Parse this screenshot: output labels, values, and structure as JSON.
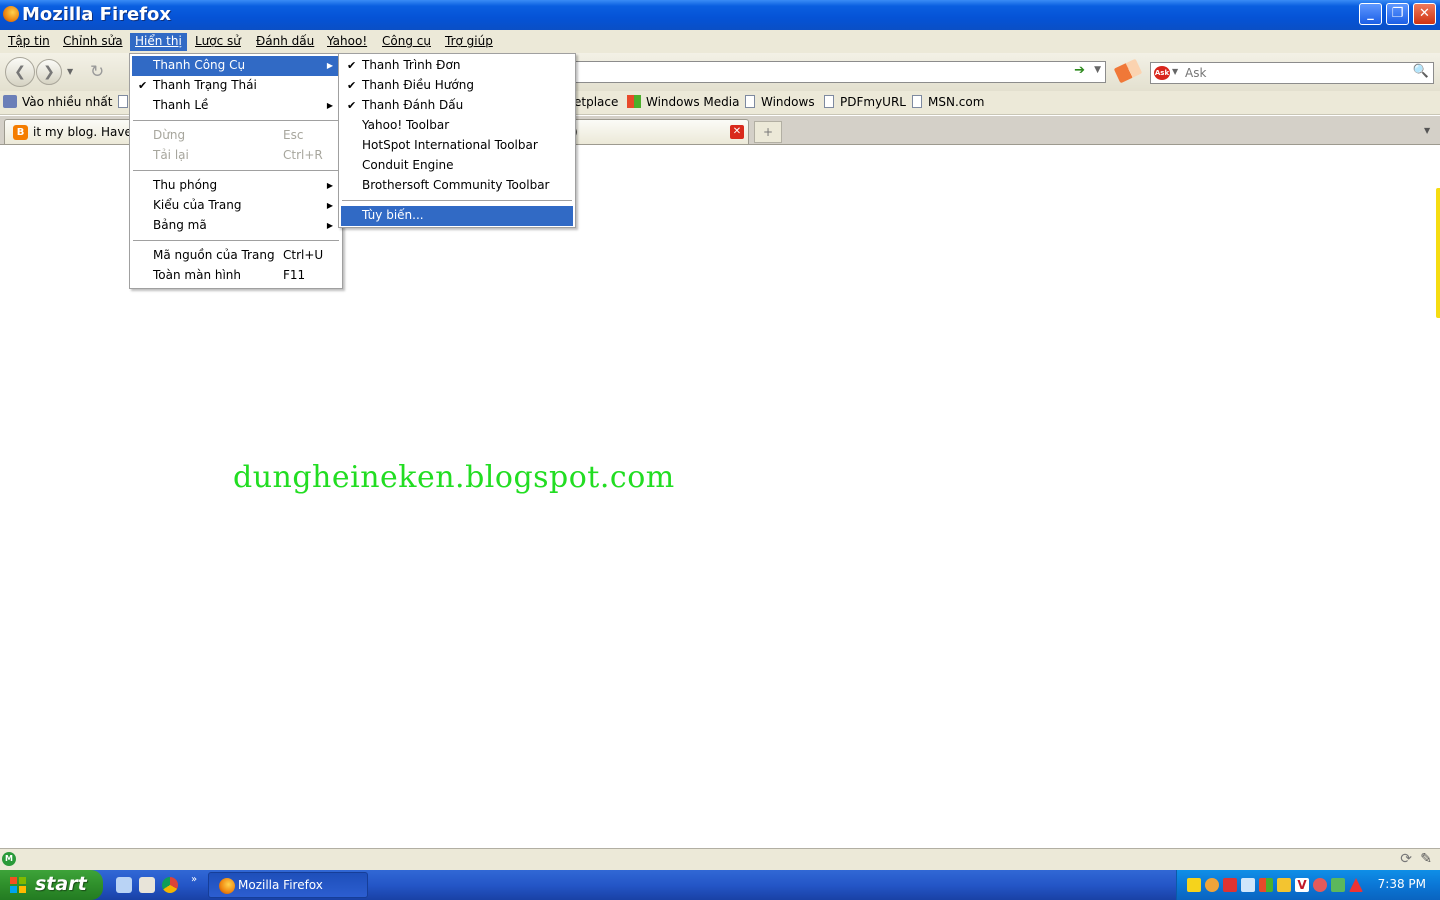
{
  "window": {
    "title": "Mozilla Firefox"
  },
  "menubar": [
    "Tập tin",
    "Chỉnh sửa",
    "Hiển thị",
    "Lược sử",
    "Đánh dấu",
    "Yahoo!",
    "Công cụ",
    "Trợ giúp"
  ],
  "view_menu": {
    "toolbars": "Thanh Công Cụ",
    "status_bar": "Thanh Trạng Thái",
    "sidebar": "Thanh Lề",
    "stop": "Dừng",
    "stop_shortcut": "Esc",
    "reload": "Tải lại",
    "reload_shortcut": "Ctrl+R",
    "zoom": "Thu phóng",
    "page_style": "Kiểu của Trang",
    "encoding": "Bảng mã",
    "page_source": "Mã nguồn của Trang",
    "page_source_shortcut": "Ctrl+U",
    "full_screen": "Toàn màn hình",
    "full_screen_shortcut": "F11"
  },
  "toolbars_submenu": {
    "menu_bar": "Thanh Trình Đơn",
    "navigation": "Thanh Điều Hướng",
    "bookmarks": "Thanh Đánh Dấu",
    "yahoo": "Yahoo! Toolbar",
    "hotspot": "HotSpot International Toolbar",
    "conduit": "Conduit Engine",
    "brothersoft": "Brothersoft Community Toolbar",
    "customize": "Tùy biến..."
  },
  "bookmarks": {
    "most_visited": "Vào nhiều nhất",
    "marketplace": "etplace",
    "windows_media": "Windows Media",
    "windows": "Windows",
    "pdfmyurl": "PDFmyURL",
    "msn": "MSN.com"
  },
  "search": {
    "placeholder": "Ask"
  },
  "tab": {
    "title": "it my blog. Have ...",
    "title_tail": ")"
  },
  "content": {
    "watermark": "dungheineken.blogspot.com"
  },
  "taskbar": {
    "start": "start",
    "firefox_task": "Mozilla Firefox",
    "clock": "7:38 PM"
  }
}
